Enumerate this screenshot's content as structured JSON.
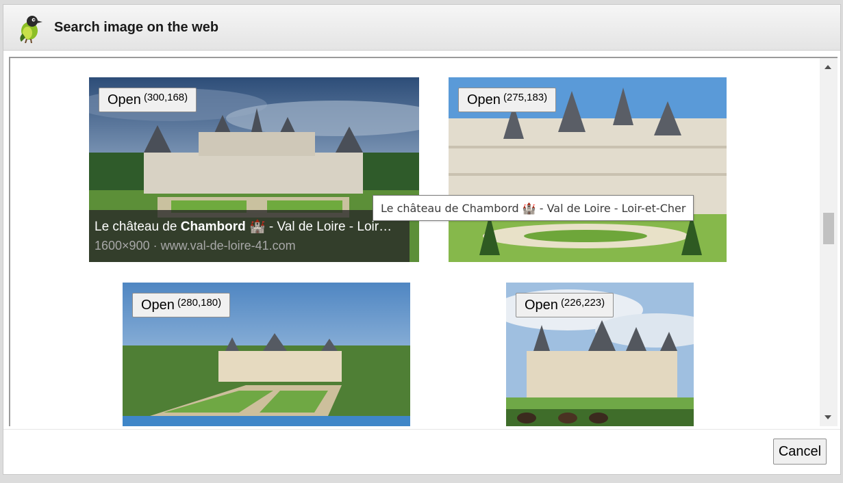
{
  "dialog": {
    "title": "Search image on the web",
    "cancel_label": "Cancel"
  },
  "results": [
    {
      "open_label": "Open",
      "size_label": "(300,168)",
      "caption_title": "Le château de Chambord 🏰 - Val de Loire - Loir…",
      "caption_sub": "1600×900 · www.val-de-loire-41.com"
    },
    {
      "open_label": "Open",
      "size_label": "(275,183)"
    },
    {
      "open_label": "Open",
      "size_label": "(280,180)"
    },
    {
      "open_label": "Open",
      "size_label": "(226,223)"
    }
  ],
  "tooltip": {
    "text": "Le château de Chambord 🏰 - Val de Loire - Loir-et-Cher"
  },
  "colors": {
    "sky_blue": "#6a9ccf",
    "lawn_green": "#5f9b3a",
    "stone": "#e4ddcf"
  },
  "icons": {
    "app": "bird-icon",
    "scroll_up": "chevron-up-icon",
    "scroll_down": "chevron-down-icon"
  }
}
